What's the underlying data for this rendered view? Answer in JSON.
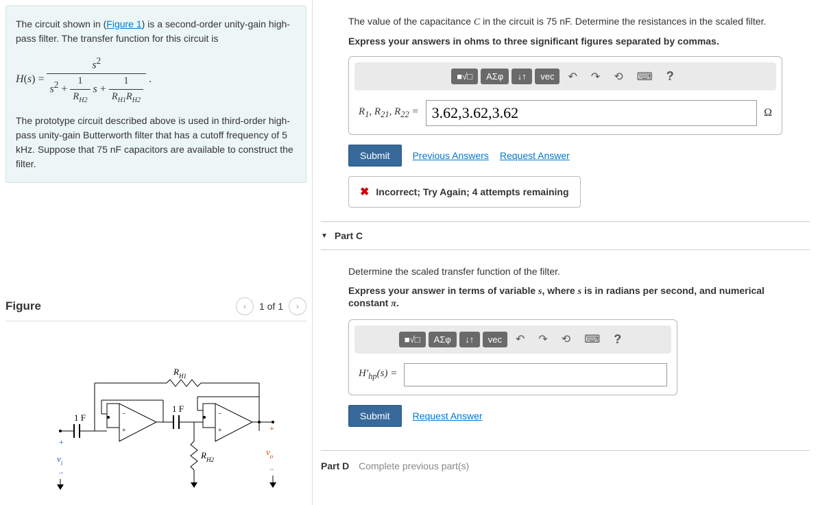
{
  "problem": {
    "intro_pre": "The circuit shown in (",
    "figure_link": "Figure 1",
    "intro_post": ") is a second-order unity-gain high-pass filter. The transfer function for this circuit is",
    "after_formula": "The prototype circuit described above is used in third-order high-pass unity-gain Butterworth filter that has a cutoff frequency of 5 kHz. Suppose that 75 nF capacitors are available to construct the filter."
  },
  "figure": {
    "title": "Figure",
    "page": "1 of 1",
    "labels": {
      "rh1": "R_H1",
      "rh2": "R_H2",
      "c1": "1 F",
      "c2": "1 F",
      "vi": "v_i",
      "vo": "v_o"
    }
  },
  "partB": {
    "prompt_pre": "The value of the capacitance ",
    "prompt_var": "C",
    "prompt_mid": " in the circuit is 75 ",
    "prompt_unit": "nF",
    "prompt_post": ". Determine the resistances in the scaled filter.",
    "instruction": "Express your answers in ohms to three significant figures separated by commas.",
    "toolbar": {
      "templates": "■√□",
      "greek": "ΑΣφ",
      "subscript": "↓↑",
      "vec": "vec"
    },
    "label": "R₁, R₂₁, R₂₂ =",
    "value": "3.62,3.62,3.62",
    "unit": "Ω",
    "submit": "Submit",
    "prev": "Previous Answers",
    "request": "Request Answer",
    "feedback": "Incorrect; Try Again; 4 attempts remaining"
  },
  "partC": {
    "title": "Part C",
    "prompt": "Determine the scaled transfer function of the filter.",
    "instruction_pre": "Express your answer in terms of variable ",
    "instruction_var": "s",
    "instruction_mid": ", where ",
    "instruction_var2": "s",
    "instruction_mid2": " is in radians per second, and numerical constant ",
    "instruction_pi": "π",
    "instruction_post": ".",
    "toolbar": {
      "templates": "■√□",
      "greek": "ΑΣφ",
      "subscript": "↓↑",
      "vec": "vec"
    },
    "label": "H′_hp(s) =",
    "value": "",
    "submit": "Submit",
    "request": "Request Answer"
  },
  "partD": {
    "label": "Part D",
    "text": "Complete previous part(s)"
  }
}
